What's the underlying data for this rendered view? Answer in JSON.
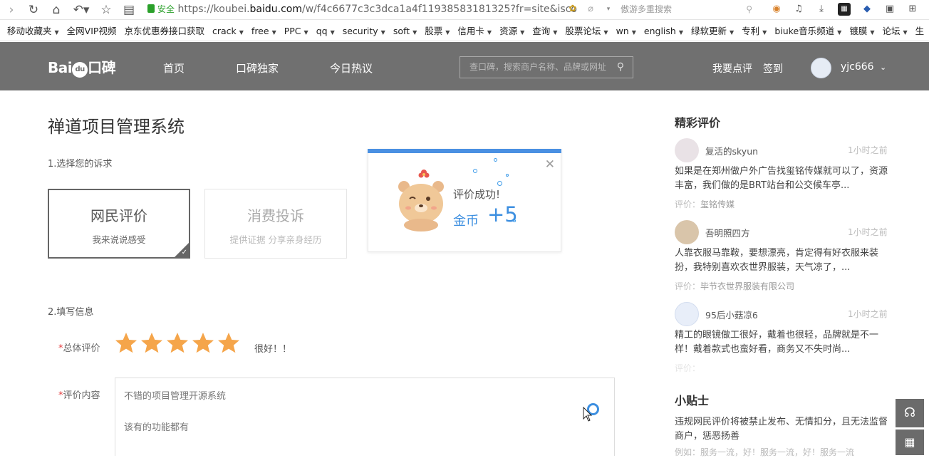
{
  "browser": {
    "url_secure_label": "安全",
    "url_prefix": "https://koubei.",
    "url_host": "baidu.com",
    "url_path": "/w/f4c6677c3c3dca1a4f11938583181325?fr=site&isco",
    "search_placeholder": "傲游多重搜索"
  },
  "bookmarks": [
    {
      "label": "移动收藏夹",
      "folder": true
    },
    {
      "label": "全网VIP视频",
      "folder": false
    },
    {
      "label": "京东优惠券接口获取",
      "folder": false
    },
    {
      "label": "crack",
      "folder": true
    },
    {
      "label": "free",
      "folder": true
    },
    {
      "label": "PPC",
      "folder": true
    },
    {
      "label": "qq",
      "folder": true
    },
    {
      "label": "security",
      "folder": true
    },
    {
      "label": "soft",
      "folder": true
    },
    {
      "label": "股票",
      "folder": true
    },
    {
      "label": "信用卡",
      "folder": true
    },
    {
      "label": "资源",
      "folder": true
    },
    {
      "label": "查询",
      "folder": true
    },
    {
      "label": "股票论坛",
      "folder": true
    },
    {
      "label": "wn",
      "folder": true
    },
    {
      "label": "english",
      "folder": true
    },
    {
      "label": "绿软更新",
      "folder": true
    },
    {
      "label": "专利",
      "folder": true
    },
    {
      "label": "biuke音乐频道",
      "folder": true
    },
    {
      "label": "镀膜",
      "folder": true
    },
    {
      "label": "论坛",
      "folder": true
    },
    {
      "label": "生",
      "folder": false
    }
  ],
  "header": {
    "logo_text": "Bai",
    "logo_du": "du",
    "logo_brand": "口碑",
    "nav": [
      "首页",
      "口碑独家",
      "今日热议"
    ],
    "search_placeholder": "查口碑，搜索商户名称、品牌或网址",
    "write_review": "我要点评",
    "sign_in": "签到",
    "username": "yjc666"
  },
  "main": {
    "title": "禅道项目管理系统",
    "step1": "1.选择您的诉求",
    "choices": [
      {
        "title": "网民评价",
        "subtitle": "我来说说感受",
        "selected": true
      },
      {
        "title": "消费投诉",
        "subtitle": "提供证据 分享亲身经历",
        "selected": false
      }
    ],
    "step2": "2.填写信息",
    "rating_label": "总体评价",
    "rating_required_mark": "*",
    "rating_stars": 5,
    "rating_max": 5,
    "rating_text": "很好！！",
    "content_label": "评价内容",
    "content_required_mark": "*",
    "content_lines": [
      "不错的项目管理开源系统",
      "该有的功能都有"
    ]
  },
  "popup": {
    "title": "评价成功!",
    "coin_label": "金币",
    "coin_value": "+5"
  },
  "sidebar": {
    "reviews_title": "精彩评价",
    "reviews": [
      {
        "user": "复活的skyun",
        "time": "1小时之前",
        "text": "如果是在郑州做户外广告找玺铭传媒就可以了，资源丰富，我们做的是BRT站台和公交候车亭...",
        "biz_key": "评价：",
        "biz": "玺铭传媒"
      },
      {
        "user": "吾明照四方",
        "time": "1小时之前",
        "text": "人靠衣服马靠鞍，要想漂亮，肯定得有好衣服来装扮，我特别喜欢衣世界服装，天气凉了，...",
        "biz_key": "评价：",
        "biz": "毕节衣世界服装有限公司"
      },
      {
        "user": "95后小菇凉6",
        "time": "1小时之前",
        "text": "精工的眼镜做工很好，戴着也很轻，品牌就是不一样！戴着款式也蛮好看，商务又不失时尚...",
        "biz_key": "评价：",
        "biz": ""
      }
    ],
    "tips_title": "小贴士",
    "tips_text": "违规网民评价将被禁止发布、无情扣分，且无法监督商户，惩恶扬善",
    "tips_example": "例如：服务一流，好！服务一流，好！服务一流"
  },
  "colors": {
    "header_bg": "#707070",
    "accent_blue": "#3d8fe0",
    "star_orange": "#f5a54a",
    "secure_green": "#2aa02a"
  },
  "icons": [
    "forward-icon",
    "refresh-icon",
    "home-icon",
    "undo-icon",
    "star-icon",
    "reader-icon",
    "lock-icon",
    "bee-icon",
    "leaf-icon",
    "search-icon",
    "extension-icon",
    "headset-icon",
    "qr-code-icon",
    "close-icon"
  ]
}
